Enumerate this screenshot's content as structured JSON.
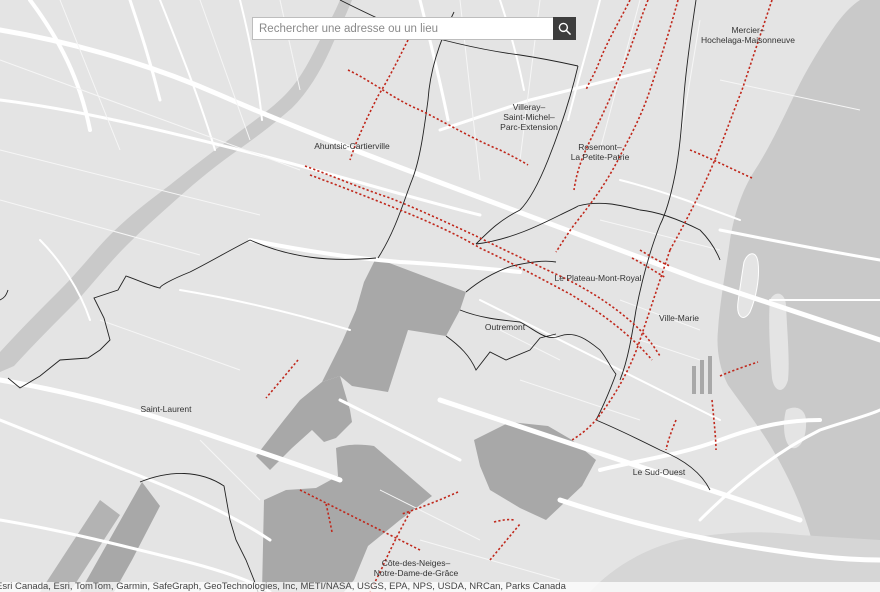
{
  "search": {
    "placeholder": "Rechercher une adresse ou un lieu",
    "button_icon": "search-icon"
  },
  "map": {
    "labels": [
      {
        "id": "mercier",
        "lines": [
          "Mercier–",
          "Hochelaga-Maisonneuve"
        ]
      },
      {
        "id": "villeray",
        "lines": [
          "Villeray–",
          "Saint-Michel–",
          "Parc-Extension"
        ]
      },
      {
        "id": "rosemont",
        "lines": [
          "Rosemont–",
          "La Petite-Patrie"
        ]
      },
      {
        "id": "ahuntsic",
        "lines": [
          "Ahuntsic-Cartierville"
        ]
      },
      {
        "id": "plateau",
        "lines": [
          "Le Plateau-Mont-Royal"
        ]
      },
      {
        "id": "villemarie",
        "lines": [
          "Ville-Marie"
        ]
      },
      {
        "id": "outremont",
        "lines": [
          "Outremont"
        ]
      },
      {
        "id": "saintlaurent",
        "lines": [
          "Saint-Laurent"
        ]
      },
      {
        "id": "sudouest",
        "lines": [
          "Le Sud-Ouest"
        ]
      },
      {
        "id": "cdn",
        "lines": [
          "Côte-des-Neiges–",
          "Notre-Dame-de-Grâce"
        ]
      }
    ],
    "colors": {
      "background": "#e4e4e4",
      "water": "#c9c9c9",
      "roads": "#ffffff",
      "boundary": "#222222",
      "excluded_area": "#a8a8a8",
      "highlight_lines": "#c0281c"
    }
  },
  "attribution": "Esri Canada, Esri, TomTom, Garmin, SafeGraph, GeoTechnologies, Inc, METI/NASA, USGS, EPA, NPS, USDA, NRCan, Parks Canada"
}
